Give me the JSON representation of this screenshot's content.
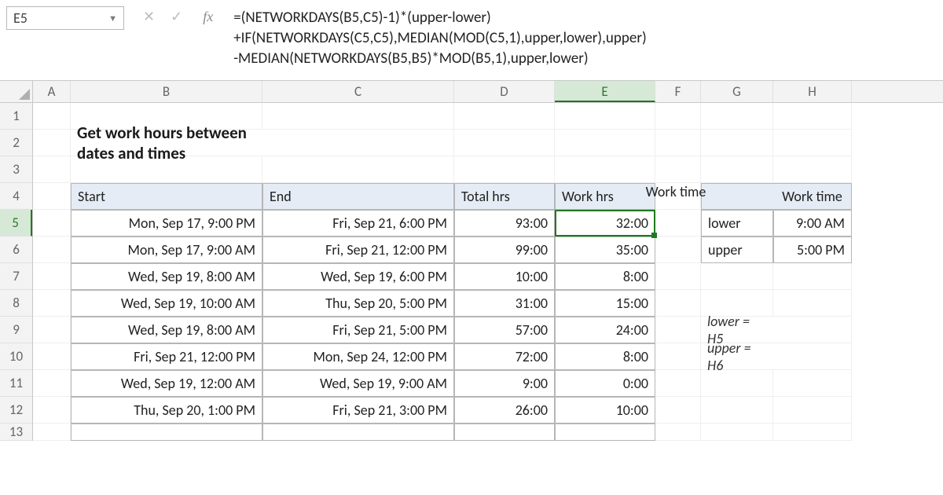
{
  "namebox": {
    "value": "E5"
  },
  "formula": {
    "line1": "=(NETWORKDAYS(B5,C5)-1)*(upper-lower)",
    "line2": "+IF(NETWORKDAYS(C5,C5),MEDIAN(MOD(C5,1),upper,lower),upper)",
    "line3": "-MEDIAN(NETWORKDAYS(B5,B5)*MOD(B5,1),upper,lower)"
  },
  "colHeaders": [
    "A",
    "B",
    "C",
    "D",
    "E",
    "F",
    "G",
    "H"
  ],
  "rowHeaders": [
    "1",
    "2",
    "3",
    "4",
    "5",
    "6",
    "7",
    "8",
    "9",
    "10",
    "11",
    "12",
    "13"
  ],
  "activeCol": "E",
  "activeRow": "5",
  "title": "Get work hours between dates and times",
  "headers": {
    "start": "Start",
    "end": "End",
    "total": "Total hrs",
    "work": "Work hrs"
  },
  "rows": [
    {
      "start": "Mon, Sep 17, 9:00 PM",
      "end": "Fri, Sep 21, 6:00 PM",
      "total": "93:00",
      "work": "32:00"
    },
    {
      "start": "Mon, Sep 17, 9:00 AM",
      "end": "Fri, Sep 21, 12:00 PM",
      "total": "99:00",
      "work": "35:00"
    },
    {
      "start": "Wed, Sep 19, 8:00 AM",
      "end": "Wed, Sep 19, 6:00 PM",
      "total": "10:00",
      "work": "8:00"
    },
    {
      "start": "Wed, Sep 19, 10:00 AM",
      "end": "Thu, Sep 20, 5:00 PM",
      "total": "31:00",
      "work": "15:00"
    },
    {
      "start": "Wed, Sep 19, 8:00 AM",
      "end": "Fri, Sep 21, 5:00 PM",
      "total": "57:00",
      "work": "24:00"
    },
    {
      "start": "Fri, Sep 21, 12:00 PM",
      "end": "Mon, Sep 24, 12:00 PM",
      "total": "72:00",
      "work": "8:00"
    },
    {
      "start": "Wed, Sep 19, 12:00 AM",
      "end": "Wed, Sep 19, 9:00 AM",
      "total": "9:00",
      "work": "0:00"
    },
    {
      "start": "Thu, Sep 20, 1:00 PM",
      "end": "Fri, Sep 21, 3:00 PM",
      "total": "26:00",
      "work": "10:00"
    }
  ],
  "workTime": {
    "header": "Work time",
    "lowerLabel": "lower",
    "lowerVal": "9:00 AM",
    "upperLabel": "upper",
    "upperVal": "5:00 PM"
  },
  "notes": {
    "n1": "lower = H5",
    "n2": "upper = H6"
  }
}
